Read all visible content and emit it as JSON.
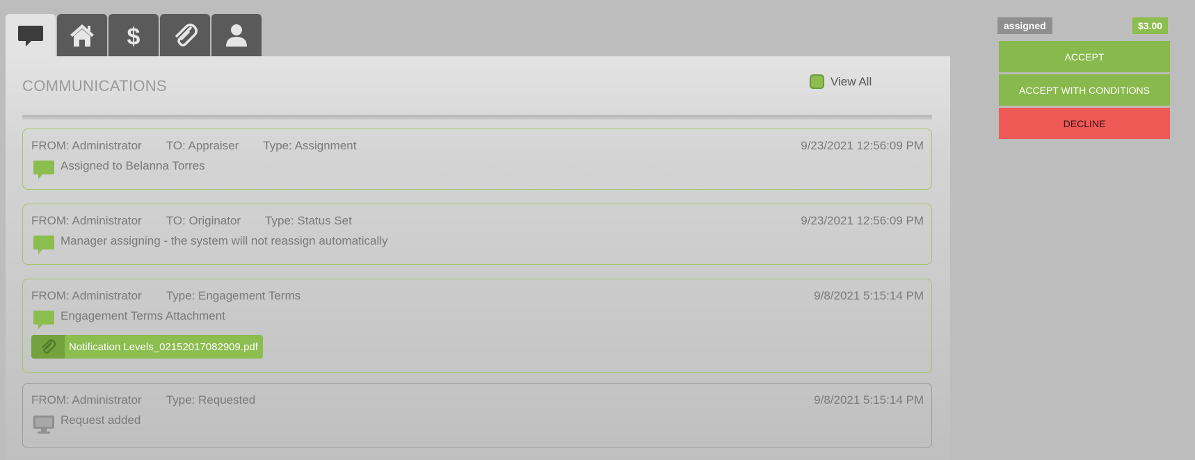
{
  "tabs": [
    {
      "id": "communications",
      "icon": "speech-bubble-icon",
      "active": true
    },
    {
      "id": "property",
      "icon": "home-icon",
      "active": false
    },
    {
      "id": "fees",
      "icon": "dollar-icon",
      "active": false
    },
    {
      "id": "attachments",
      "icon": "paperclip-icon",
      "active": false
    },
    {
      "id": "contacts",
      "icon": "user-icon",
      "active": false
    }
  ],
  "section": {
    "title": "COMMUNICATIONS",
    "view_all_label": "View All",
    "view_all_checked": true
  },
  "messages": [
    {
      "from": "FROM: Administrator",
      "to": "TO: Appraiser",
      "type": "Type: Assignment",
      "date": "9/23/2021 12:56:09 PM",
      "body": "Assigned to Belanna Torres",
      "icon": "speech-bubble-icon"
    },
    {
      "from": "FROM: Administrator",
      "to": "TO: Originator",
      "type": "Type: Status Set",
      "date": "9/23/2021 12:56:09 PM",
      "body": "Manager assigning - the system will not reassign automatically",
      "icon": "speech-bubble-icon"
    },
    {
      "from": "FROM: Administrator",
      "type": "Type: Engagement Terms",
      "date": "9/8/2021 5:15:14 PM",
      "body": "Engagement Terms Attachment",
      "icon": "speech-bubble-icon",
      "attachment": "Notification Levels_02152017082909.pdf"
    },
    {
      "from": "FROM: Administrator",
      "type": "Type: Requested",
      "date": "9/8/2021 5:15:14 PM",
      "body": "Request added",
      "icon": "monitor-icon"
    }
  ],
  "sidebar": {
    "status": "assigned",
    "price": "$3.00",
    "accept_label": "ACCEPT",
    "accept_conditions_label": "ACCEPT WITH CONDITIONS",
    "decline_label": "DECLINE"
  },
  "colors": {
    "accent_green": "#8bbd4f",
    "decline_red": "#ee5a56",
    "tab_dark": "#5a5a5a"
  }
}
